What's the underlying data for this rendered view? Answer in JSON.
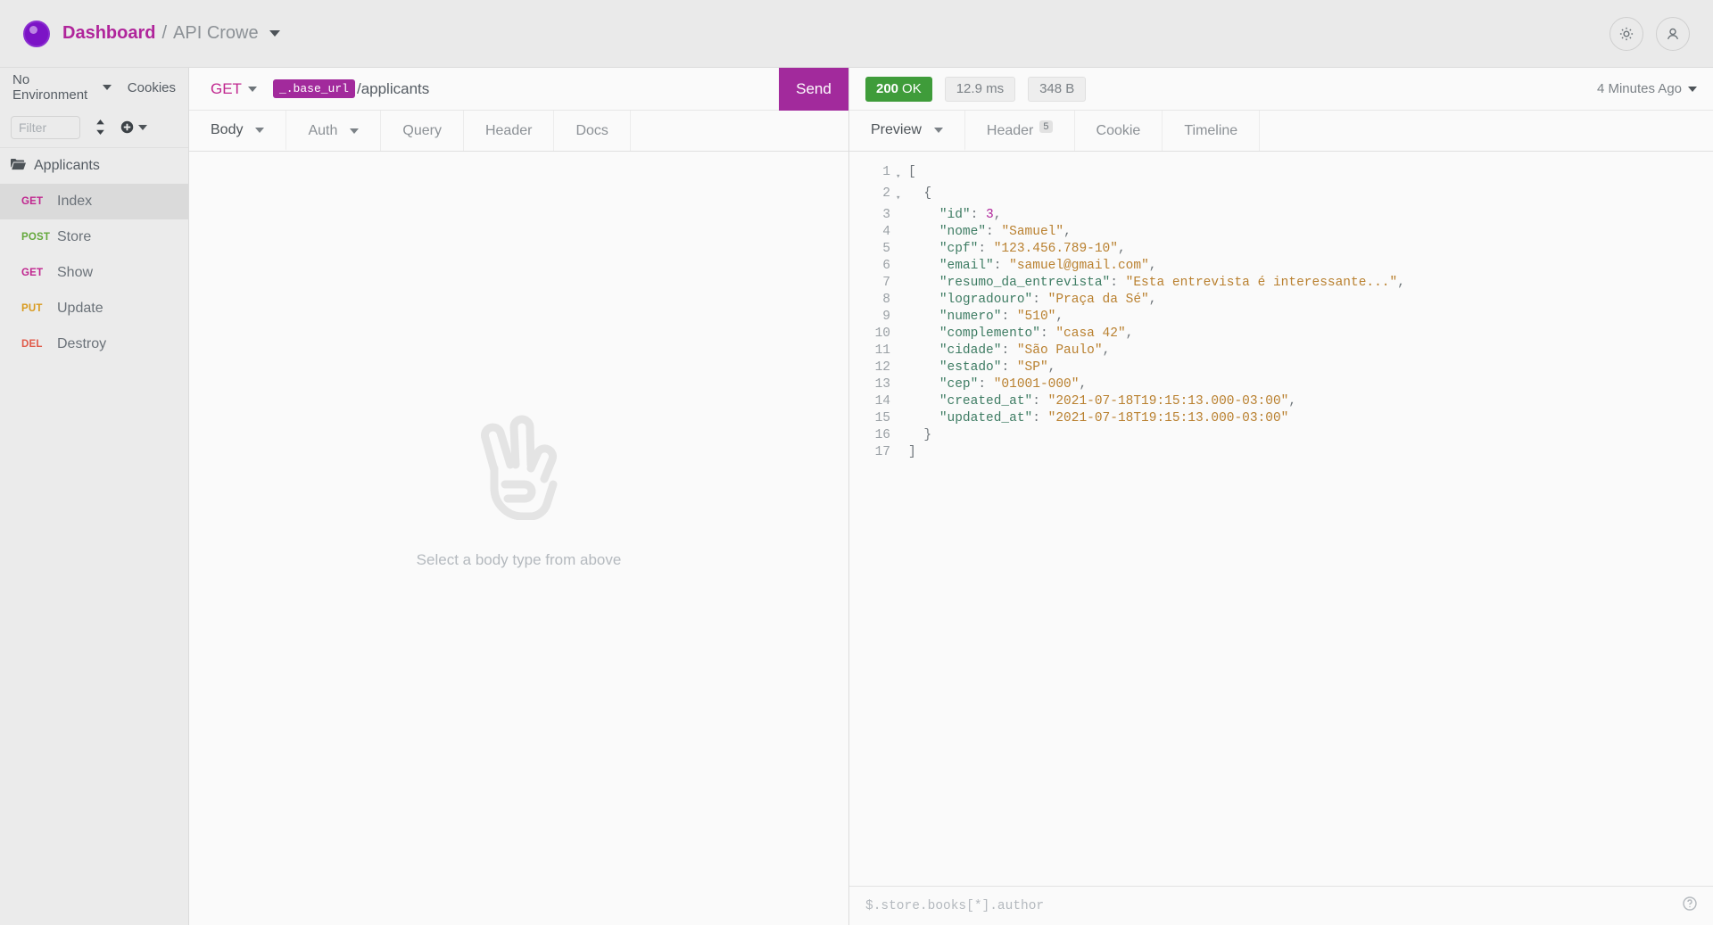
{
  "topbar": {
    "breadcrumb": {
      "dashboard": "Dashboard",
      "separator": "/",
      "project": "API Crowe"
    },
    "logo_icon": "app-logo-icon",
    "settings_icon": "gear-icon",
    "account_icon": "user-avatar-icon",
    "brand_color": "#7c13c6",
    "accent_color": "#b0259b"
  },
  "sidebar": {
    "environment_label": "No Environment",
    "cookies_label": "Cookies",
    "filter_placeholder": "Filter",
    "filter_value": "",
    "sort_icon": "sort-updown-icon",
    "add_icon": "add-circle-icon",
    "folder": {
      "label": "Applicants",
      "icon": "folder-open-icon"
    },
    "requests": [
      {
        "method": "GET",
        "name": "Index",
        "active": true
      },
      {
        "method": "POST",
        "name": "Store",
        "active": false
      },
      {
        "method": "GET",
        "name": "Show",
        "active": false
      },
      {
        "method": "PUT",
        "name": "Update",
        "active": false
      },
      {
        "method": "DEL",
        "name": "Destroy",
        "active": false
      }
    ]
  },
  "request": {
    "method": "GET",
    "url_variable": "_.base_url",
    "url_path": "/applicants",
    "send_label": "Send",
    "tabs": [
      {
        "label": "Body",
        "active": true,
        "caret": true,
        "badge": ""
      },
      {
        "label": "Auth",
        "active": false,
        "caret": true,
        "badge": ""
      },
      {
        "label": "Query",
        "active": false,
        "caret": false,
        "badge": ""
      },
      {
        "label": "Header",
        "active": false,
        "caret": false,
        "badge": ""
      },
      {
        "label": "Docs",
        "active": false,
        "caret": false,
        "badge": ""
      }
    ],
    "empty_state": {
      "icon": "peace-hand-icon",
      "caption": "Select a body type from above"
    }
  },
  "response": {
    "status_code": "200",
    "status_text": "OK",
    "duration": "12.9 ms",
    "size": "348 B",
    "timestamp": "4 Minutes Ago",
    "status_color": "#3f9c3a",
    "tabs": [
      {
        "label": "Preview",
        "active": true,
        "caret": true,
        "badge": ""
      },
      {
        "label": "Header",
        "active": false,
        "caret": false,
        "badge": "5"
      },
      {
        "label": "Cookie",
        "active": false,
        "caret": false,
        "badge": ""
      },
      {
        "label": "Timeline",
        "active": false,
        "caret": false,
        "badge": ""
      }
    ],
    "jsonpath_placeholder": "$.store.books[*].author",
    "jsonpath_value": "",
    "help_icon": "help-circle-icon",
    "code_lines": [
      {
        "no": "1",
        "fold": "▾",
        "segments": [
          {
            "t": "[",
            "c": "p"
          }
        ]
      },
      {
        "no": "2",
        "fold": "▾",
        "segments": [
          {
            "t": "  {",
            "c": "p"
          }
        ]
      },
      {
        "no": "3",
        "fold": "",
        "segments": [
          {
            "t": "    ",
            "c": "p"
          },
          {
            "t": "\"id\"",
            "c": "k"
          },
          {
            "t": ": ",
            "c": "p"
          },
          {
            "t": "3",
            "c": "n"
          },
          {
            "t": ",",
            "c": "p"
          }
        ]
      },
      {
        "no": "4",
        "fold": "",
        "segments": [
          {
            "t": "    ",
            "c": "p"
          },
          {
            "t": "\"nome\"",
            "c": "k"
          },
          {
            "t": ": ",
            "c": "p"
          },
          {
            "t": "\"Samuel\"",
            "c": "s"
          },
          {
            "t": ",",
            "c": "p"
          }
        ]
      },
      {
        "no": "5",
        "fold": "",
        "segments": [
          {
            "t": "    ",
            "c": "p"
          },
          {
            "t": "\"cpf\"",
            "c": "k"
          },
          {
            "t": ": ",
            "c": "p"
          },
          {
            "t": "\"123.456.789-10\"",
            "c": "s"
          },
          {
            "t": ",",
            "c": "p"
          }
        ]
      },
      {
        "no": "6",
        "fold": "",
        "segments": [
          {
            "t": "    ",
            "c": "p"
          },
          {
            "t": "\"email\"",
            "c": "k"
          },
          {
            "t": ": ",
            "c": "p"
          },
          {
            "t": "\"samuel@gmail.com\"",
            "c": "s"
          },
          {
            "t": ",",
            "c": "p"
          }
        ]
      },
      {
        "no": "7",
        "fold": "",
        "segments": [
          {
            "t": "    ",
            "c": "p"
          },
          {
            "t": "\"resumo_da_entrevista\"",
            "c": "k"
          },
          {
            "t": ": ",
            "c": "p"
          },
          {
            "t": "\"Esta entrevista é interessante...\"",
            "c": "s"
          },
          {
            "t": ",",
            "c": "p"
          }
        ]
      },
      {
        "no": "8",
        "fold": "",
        "segments": [
          {
            "t": "    ",
            "c": "p"
          },
          {
            "t": "\"logradouro\"",
            "c": "k"
          },
          {
            "t": ": ",
            "c": "p"
          },
          {
            "t": "\"Praça da Sé\"",
            "c": "s"
          },
          {
            "t": ",",
            "c": "p"
          }
        ]
      },
      {
        "no": "9",
        "fold": "",
        "segments": [
          {
            "t": "    ",
            "c": "p"
          },
          {
            "t": "\"numero\"",
            "c": "k"
          },
          {
            "t": ": ",
            "c": "p"
          },
          {
            "t": "\"510\"",
            "c": "s"
          },
          {
            "t": ",",
            "c": "p"
          }
        ]
      },
      {
        "no": "10",
        "fold": "",
        "segments": [
          {
            "t": "    ",
            "c": "p"
          },
          {
            "t": "\"complemento\"",
            "c": "k"
          },
          {
            "t": ": ",
            "c": "p"
          },
          {
            "t": "\"casa 42\"",
            "c": "s"
          },
          {
            "t": ",",
            "c": "p"
          }
        ]
      },
      {
        "no": "11",
        "fold": "",
        "segments": [
          {
            "t": "    ",
            "c": "p"
          },
          {
            "t": "\"cidade\"",
            "c": "k"
          },
          {
            "t": ": ",
            "c": "p"
          },
          {
            "t": "\"São Paulo\"",
            "c": "s"
          },
          {
            "t": ",",
            "c": "p"
          }
        ]
      },
      {
        "no": "12",
        "fold": "",
        "segments": [
          {
            "t": "    ",
            "c": "p"
          },
          {
            "t": "\"estado\"",
            "c": "k"
          },
          {
            "t": ": ",
            "c": "p"
          },
          {
            "t": "\"SP\"",
            "c": "s"
          },
          {
            "t": ",",
            "c": "p"
          }
        ]
      },
      {
        "no": "13",
        "fold": "",
        "segments": [
          {
            "t": "    ",
            "c": "p"
          },
          {
            "t": "\"cep\"",
            "c": "k"
          },
          {
            "t": ": ",
            "c": "p"
          },
          {
            "t": "\"01001-000\"",
            "c": "s"
          },
          {
            "t": ",",
            "c": "p"
          }
        ]
      },
      {
        "no": "14",
        "fold": "",
        "segments": [
          {
            "t": "    ",
            "c": "p"
          },
          {
            "t": "\"created_at\"",
            "c": "k"
          },
          {
            "t": ": ",
            "c": "p"
          },
          {
            "t": "\"2021-07-18T19:15:13.000-03:00\"",
            "c": "s"
          },
          {
            "t": ",",
            "c": "p"
          }
        ]
      },
      {
        "no": "15",
        "fold": "",
        "segments": [
          {
            "t": "    ",
            "c": "p"
          },
          {
            "t": "\"updated_at\"",
            "c": "k"
          },
          {
            "t": ": ",
            "c": "p"
          },
          {
            "t": "\"2021-07-18T19:15:13.000-03:00\"",
            "c": "s"
          }
        ]
      },
      {
        "no": "16",
        "fold": "",
        "segments": [
          {
            "t": "  }",
            "c": "p"
          }
        ]
      },
      {
        "no": "17",
        "fold": "",
        "segments": [
          {
            "t": "]",
            "c": "p"
          }
        ]
      }
    ]
  }
}
